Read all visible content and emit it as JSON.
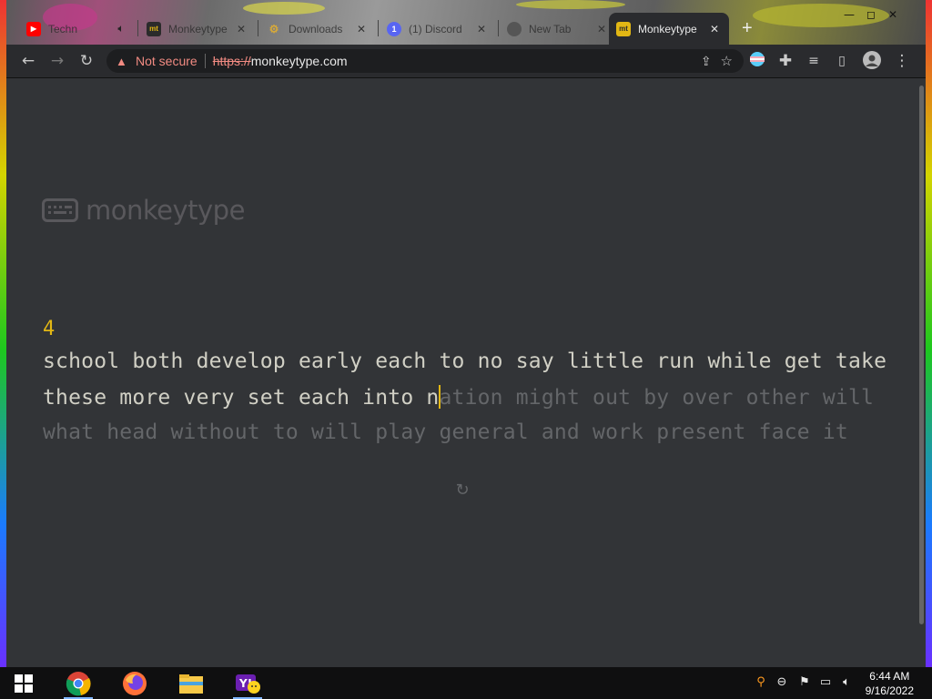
{
  "browser": {
    "tabs": [
      {
        "title": "Techn",
        "icon": "youtube-icon"
      },
      {
        "title": "Monkeytype",
        "icon": "monkeytype-icon"
      },
      {
        "title": "Downloads",
        "icon": "downloads-icon"
      },
      {
        "title": "(1) Discord",
        "icon": "discord-icon"
      },
      {
        "title": "New Tab",
        "icon": "chrome-icon"
      },
      {
        "title": "Monkeytype",
        "icon": "monkeytype-icon",
        "active": true
      }
    ],
    "new_tab_label": "+",
    "tab_close_glyph": "✕",
    "window_controls": {
      "minimize": "—",
      "maximize": "◻",
      "close": "✕"
    },
    "nav": {
      "back": "←",
      "forward": "→",
      "reload": "↻"
    },
    "omnibox": {
      "security_label": "Not secure",
      "url_scheme": "https://",
      "url_host": "monkeytype.com"
    }
  },
  "page": {
    "logo_text": "monkeytype",
    "word_counter": "4",
    "lines": {
      "line1": "school both develop early each to no say little run while get take",
      "line2_typed": "these more very set each into n",
      "line2_untyped": "ation might out by over other will",
      "line3": "what head without to will play general and work present face it"
    },
    "restart_glyph": "↻"
  },
  "taskbar": {
    "apps": [
      "chrome-icon",
      "firefox-icon",
      "file-explorer-icon",
      "yahoo-messenger-icon"
    ],
    "clock_time": "6:44 AM",
    "clock_date": "9/16/2022"
  },
  "colors": {
    "page_bg": "#323437",
    "main_text": "#d1d0c5",
    "sub_text": "#646669",
    "accent": "#e2b714",
    "warning": "#f28b82"
  }
}
